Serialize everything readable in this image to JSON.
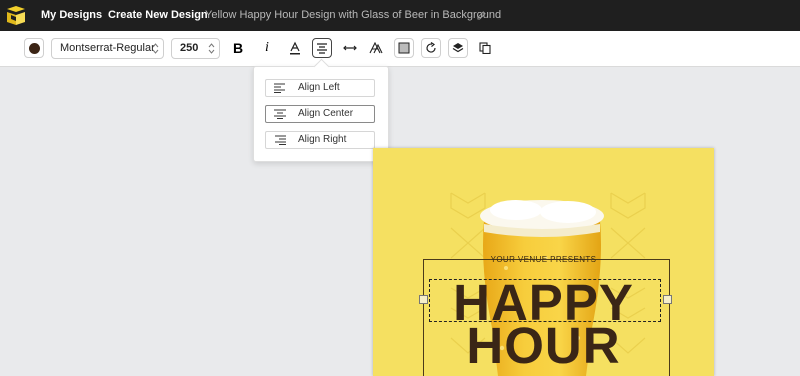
{
  "header": {
    "nav_my_designs": "My Designs",
    "nav_create": "Create New Design",
    "doc_title": "Yellow Happy Hour Design with Glass of Beer in Background"
  },
  "toolbar": {
    "text_color": "#3b2415",
    "font": "Montserrat-Regular",
    "font_size": "250",
    "bold_label": "B",
    "italic_label": "i",
    "icons": [
      "color-swatch",
      "bold",
      "italic",
      "text-color",
      "align-center",
      "letter-spacing",
      "text-effects",
      "background",
      "rotate",
      "layers",
      "duplicate"
    ]
  },
  "align_menu": {
    "options": [
      {
        "label": "Align Left",
        "icon": "align-left-icon",
        "selected": false
      },
      {
        "label": "Align Center",
        "icon": "align-center-icon",
        "selected": true
      },
      {
        "label": "Align Right",
        "icon": "align-right-icon",
        "selected": false
      }
    ]
  },
  "design": {
    "background_color": "#f5e061",
    "text_color": "#3a2616",
    "venue_text": "YOUR VENUE PRESENTS",
    "headline_1": "HAPPY",
    "headline_2": "HOUR"
  }
}
